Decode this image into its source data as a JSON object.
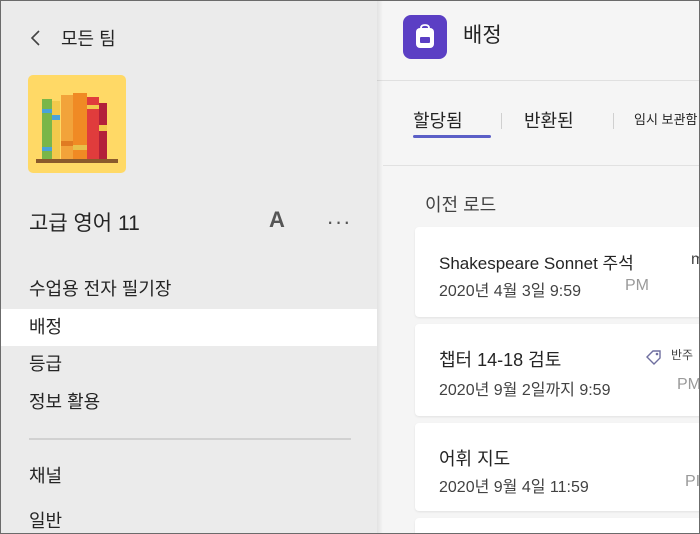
{
  "sidebar": {
    "back_label": "모든 팀",
    "team_name": "고급 영어 11",
    "team_badge": "A",
    "more_label": "···",
    "nav": [
      {
        "label": "수업용 전자 필기장"
      },
      {
        "label": "배정"
      },
      {
        "label": "등급"
      },
      {
        "label": "정보 활용"
      }
    ],
    "channels": [
      {
        "label": "채널"
      },
      {
        "label": "일반"
      }
    ]
  },
  "header": {
    "title": "배정"
  },
  "tabs": [
    {
      "label": "할당됨"
    },
    {
      "label": "반환된"
    },
    {
      "label": "임시 보관함"
    }
  ],
  "section_title": "이전 로드",
  "cards": [
    {
      "title": "Shakespeare Sonnet 주석",
      "date": "2020년 4월 3일 9:59",
      "ampm": "PM",
      "side": "m"
    },
    {
      "title": "챕터 14-18 검토",
      "date": "2020년 9월 2일까지 9:59",
      "ampm": "PM",
      "side": "반주"
    },
    {
      "title": "어휘 지도",
      "date": "2020년 9월 4일 11:59",
      "ampm": "PI",
      "side": ""
    }
  ],
  "colors": {
    "accent": "#5b5fc7",
    "app_icon_bg": "#5b3fc4",
    "sidebar_bg": "#ebebeb"
  }
}
